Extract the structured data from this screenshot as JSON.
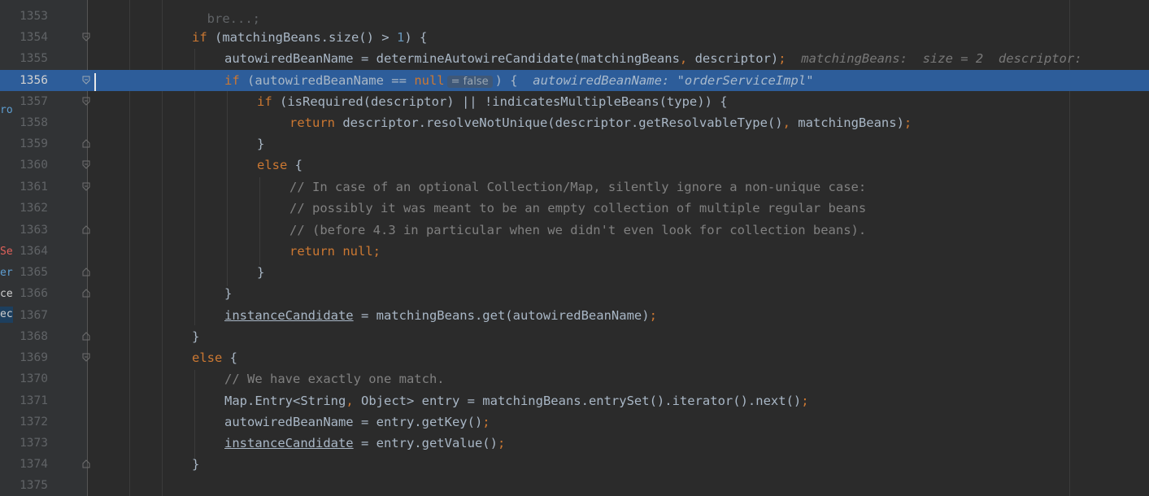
{
  "editor": {
    "top_fragment": "bre...;",
    "left_fragments": [
      {
        "text": "ro",
        "color": "#5e9ed1"
      },
      {
        "text": "Se",
        "color": "#e0615a"
      },
      {
        "text": "erv",
        "color": "#5e9ed1"
      },
      {
        "text": "ce",
        "color": "#cfcfcf"
      },
      {
        "text": "ect",
        "color": "#cfcfcf"
      }
    ],
    "highlighted_line": "1356",
    "inlay_value": "= false",
    "lines": [
      {
        "num": "1353"
      },
      {
        "num": "1354"
      },
      {
        "num": "1355"
      },
      {
        "num": "1356"
      },
      {
        "num": "1357"
      },
      {
        "num": "1358"
      },
      {
        "num": "1359"
      },
      {
        "num": "1360"
      },
      {
        "num": "1361"
      },
      {
        "num": "1362"
      },
      {
        "num": "1363"
      },
      {
        "num": "1364"
      },
      {
        "num": "1365"
      },
      {
        "num": "1366"
      },
      {
        "num": "1367"
      },
      {
        "num": "1368"
      },
      {
        "num": "1369"
      },
      {
        "num": "1370"
      },
      {
        "num": "1371"
      },
      {
        "num": "1372"
      },
      {
        "num": "1373"
      },
      {
        "num": "1374"
      },
      {
        "num": "1375"
      }
    ],
    "code": {
      "l1354_if": "if",
      "l1354_cond": " (matchingBeans.size() > ",
      "l1354_num": "1",
      "l1354_end": ") {",
      "l1355_a": "autowiredBeanName = determineAutowireCandidate(matchingBeans",
      "l1355_comma": ",",
      "l1355_b": " descriptor)",
      "l1355_semi": ";",
      "l1355_hint": "matchingBeans:  size = 2  descriptor: ",
      "l1356_if": "if",
      "l1356_a": " (autowiredBeanName == ",
      "l1356_null": "null",
      "l1356_end": ") {",
      "l1356_hint": "autowiredBeanName: \"orderServiceImpl\"",
      "l1357_if": "if",
      "l1357_a": " (isRequired(descriptor) || !indicatesMultipleBeans(type)) {",
      "l1358_ret": "return",
      "l1358_a": " descriptor.resolveNotUnique(descriptor.getResolvableType()",
      "l1358_comma": ",",
      "l1358_b": " matchingBeans)",
      "l1358_semi": ";",
      "l1359": "}",
      "l1360_else": "else",
      "l1360_brace": " {",
      "l1361": "// In case of an optional Collection/Map, silently ignore a non-unique case:",
      "l1362": "// possibly it was meant to be an empty collection of multiple regular beans",
      "l1363": "// (before 4.3 in particular when we didn't even look for collection beans).",
      "l1364_ret": "return",
      "l1364_null": " null",
      "l1364_semi": ";",
      "l1365": "}",
      "l1366": "}",
      "l1367_var": "instanceCandidate",
      "l1367_a": " = matchingBeans.get(autowiredBeanName)",
      "l1367_semi": ";",
      "l1368": "}",
      "l1369_else": "else",
      "l1369_brace": " {",
      "l1370": "// We have exactly one match.",
      "l1371_a": "Map.Entry<String",
      "l1371_comma": ",",
      "l1371_b": " Object> entry = matchingBeans.entrySet().iterator().next()",
      "l1371_semi": ";",
      "l1372_a": "autowiredBeanName = entry.getKey()",
      "l1372_semi": ";",
      "l1373_var": "instanceCandidate",
      "l1373_a": " = entry.getValue()",
      "l1373_semi": ";",
      "l1374": "}"
    }
  }
}
